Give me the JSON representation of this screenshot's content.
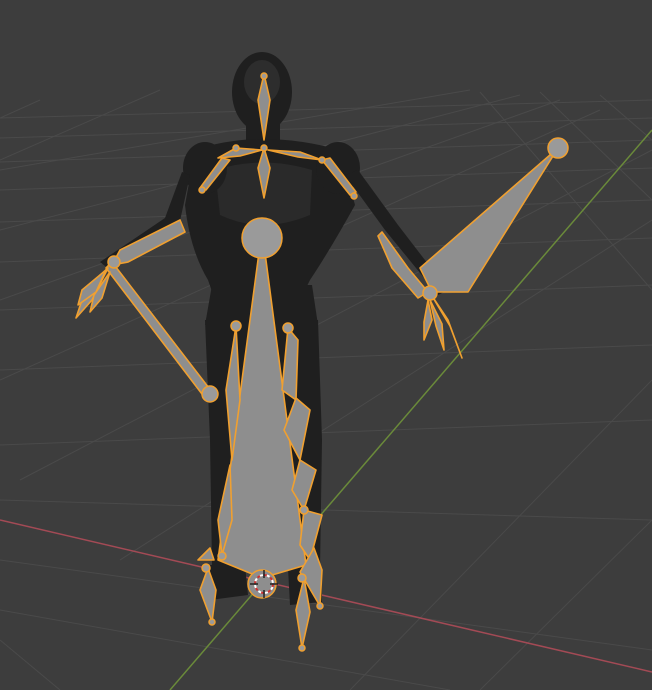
{
  "viewport": {
    "mode": "3d-viewport",
    "background_color": "#3d3d3d",
    "grid_color": "#4a4a4a",
    "x_axis_color": "#a34a55",
    "y_axis_color": "#6a8a3a"
  },
  "mesh": {
    "name": "human-mesh",
    "color": "#1f1f1f",
    "highlight_color": "#3a3a3a"
  },
  "armature": {
    "selected": true,
    "bone_fill": "#8e8e8e",
    "bone_outline": "#f0a030",
    "joint_fill": "#9a9a9a"
  },
  "cursor": {
    "name": "3d-cursor",
    "colors": [
      "#d03030",
      "#ffffff"
    ]
  }
}
